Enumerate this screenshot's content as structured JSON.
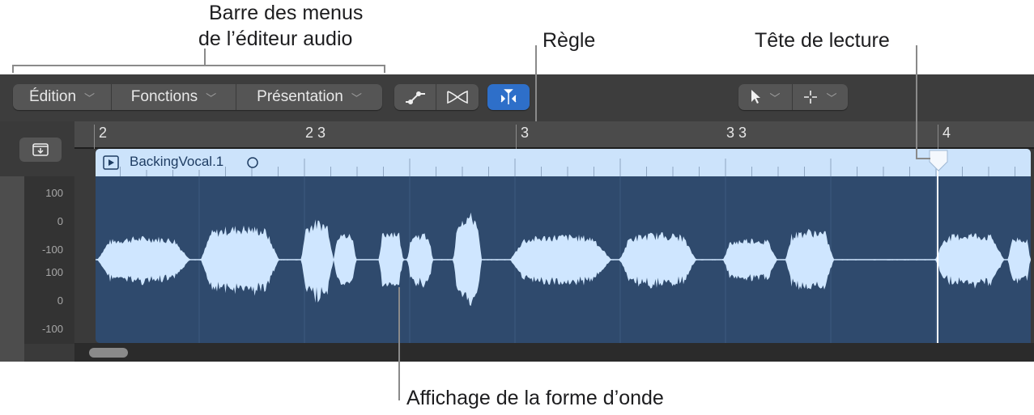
{
  "callouts": {
    "menu_bar_line1": "Barre des menus",
    "menu_bar_line2": "de l’éditeur audio",
    "ruler": "Règle",
    "playhead": "Tête de lecture",
    "waveform": "Affichage de la forme d’onde"
  },
  "toolbar": {
    "menus": [
      {
        "label": "Édition"
      },
      {
        "label": "Fonctions"
      },
      {
        "label": "Présentation"
      }
    ],
    "tools": [
      {
        "icon": "automation-curve-icon"
      },
      {
        "icon": "crossfade-icon"
      },
      {
        "icon": "flex-marker-icon",
        "active": true
      }
    ],
    "pointer_tool_icon": "pointer-arrow-icon",
    "secondary_tool_icon": "crosshair-icon",
    "chevron": "⌄"
  },
  "ruler": {
    "labels": [
      "2",
      "2 3",
      "3",
      "3 3",
      "4"
    ]
  },
  "region": {
    "name": "BackingVocal.1"
  },
  "amplitude_scale": {
    "labels": [
      "100",
      "0",
      "-100",
      "100",
      "0",
      "-100"
    ]
  },
  "colors": {
    "active_tool": "#2e6fc9",
    "region_header": "#cce3fb",
    "region_body": "#2f4a6d",
    "waveform": "#cfe6ff"
  }
}
